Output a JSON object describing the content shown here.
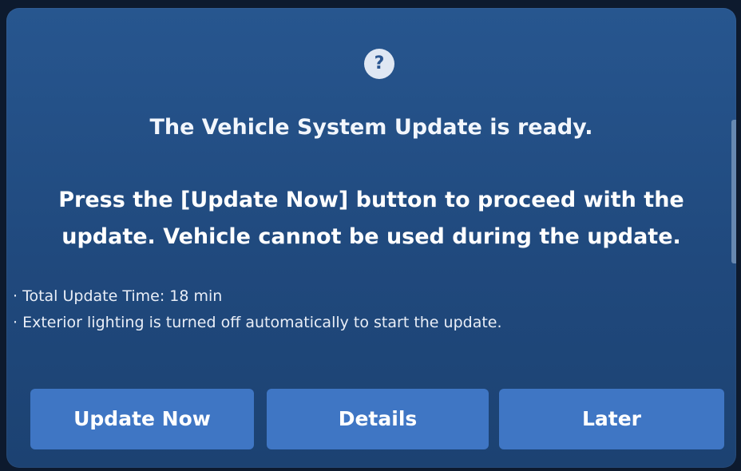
{
  "dialog": {
    "title": "The Vehicle System Update is ready.",
    "message": "Press the [Update Now] button to proceed with the update. Vehicle cannot be used during the update.",
    "notes": [
      "· Total Update Time: 18 min",
      "· Exterior lighting is turned off automatically to start the update."
    ]
  },
  "buttons": {
    "update_now": "Update Now",
    "details": "Details",
    "later": "Later"
  },
  "icons": {
    "help": "question-icon",
    "help_glyph": "?"
  },
  "colors": {
    "dialog_bg": "#24508a",
    "button_bg": "#3f76c4",
    "text": "#ffffff"
  }
}
